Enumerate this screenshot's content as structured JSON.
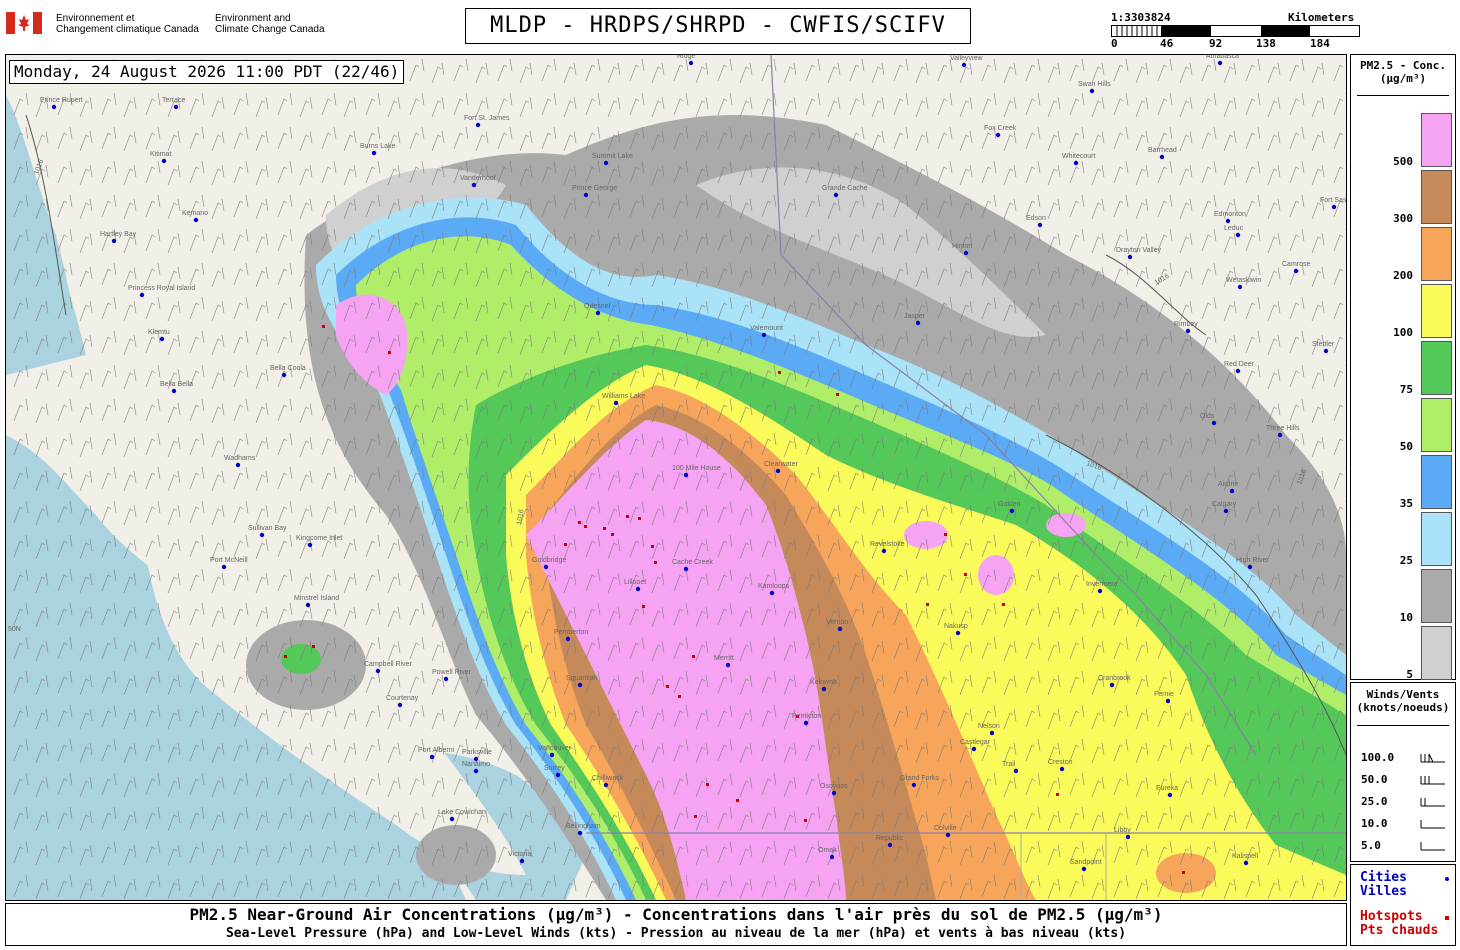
{
  "header": {
    "agency_fr_line1": "Environnement et",
    "agency_fr_line2": "Changement climatique Canada",
    "agency_en_line1": "Environment and",
    "agency_en_line2": "Climate Change Canada",
    "title": "MLDP - HRDPS/SHRPD - CWFIS/SCIFV"
  },
  "scale": {
    "ratio": "1:3303824",
    "unit": "Kilometers",
    "ticks": [
      "0",
      "46",
      "92",
      "138",
      "184"
    ]
  },
  "timestamp": "Monday, 24 August 2026 11:00 PDT (22/46)",
  "legend": {
    "title_line1": "PM2.5 - Conc.",
    "title_line2": "(µg/m³)",
    "classes": [
      {
        "value": "500",
        "color": "#f5a3f2"
      },
      {
        "value": "300",
        "color": "#c68a5a"
      },
      {
        "value": "200",
        "color": "#f7a55a"
      },
      {
        "value": "100",
        "color": "#fafa5a"
      },
      {
        "value": "75",
        "color": "#55c85a"
      },
      {
        "value": "50",
        "color": "#b0ee6a"
      },
      {
        "value": "35",
        "color": "#5aaaf5"
      },
      {
        "value": "25",
        "color": "#aae3f7"
      },
      {
        "value": "10",
        "color": "#aaaaaa"
      },
      {
        "value": "5",
        "color": "#d0d0d0"
      }
    ]
  },
  "winds": {
    "title_line1": "Winds/Vents",
    "title_line2": "(knots/noeuds)",
    "rows": [
      "100.0",
      "50.0",
      "25.0",
      "10.0",
      "5.0"
    ]
  },
  "markers": {
    "cities_en": "Cities",
    "cities_fr": "Villes",
    "cities_color": "#0000cc",
    "hotspots_en": "Hotspots",
    "hotspots_fr": "Pts chauds",
    "hotspots_color": "#cc0000"
  },
  "footer": {
    "line1": "PM2.5 Near-Ground Air Concentrations (µg/m³) - Concentrations dans l'air près du sol de PM2.5 (µg/m³)",
    "line2": "Sea-Level Pressure (hPa) and Low-Level Winds (kts) - Pression au niveau de la mer (hPa) et vents à bas niveau (kts)"
  },
  "map": {
    "isobar_labels": [
      "1016",
      "1016",
      "1016",
      "1016",
      "1016"
    ],
    "latitude_label": "50N",
    "cities": [
      "Prince Rupert",
      "Terrace",
      "Kitimat",
      "Kemano",
      "Hartley Bay",
      "Fort St. James",
      "Burns Lake",
      "Vanderhoof",
      "Prince George",
      "Summit Lake",
      "Ridge",
      "Valleyview",
      "Swan Hills",
      "Athabasca",
      "Fox Creek",
      "Whitecourt",
      "Barrhead",
      "Fort Saskatchewan",
      "Edmonton",
      "Edson",
      "Leduc",
      "Drayton Valley",
      "Camrose",
      "Wetaskiwin",
      "Rimbey",
      "Stettler",
      "Red Deer",
      "Olds",
      "Three Hills",
      "Airdrie",
      "Calgary",
      "High River",
      "Hinton",
      "Grande Cache",
      "Valemount",
      "Jasper",
      "Quesnel",
      "Williams Lake",
      "100 Mile House",
      "Clearwater",
      "Bella Coola",
      "Bella Bella",
      "Klemtu",
      "Princess Royal Island",
      "Wadhams",
      "Sullivan Bay",
      "Kingcome Inlet",
      "Port McNeill",
      "Minstrel Island",
      "Campbell River",
      "Powell River",
      "Courtenay",
      "Port Alberni",
      "Parksville",
      "Nanaimo",
      "Vancouver",
      "Surrey",
      "Lake Cowichan",
      "Victoria",
      "Bellingham",
      "Chilliwack",
      "Squamish",
      "Pemberton",
      "Lillooet",
      "Cache Creek",
      "Kamloops",
      "Merritt",
      "Kelowna",
      "Penticton",
      "Osoyoos",
      "Vernon",
      "Revelstoke",
      "Golden",
      "Invermere",
      "Nakusp",
      "Nelson",
      "Castlegar",
      "Trail",
      "Grand Forks",
      "Republic",
      "Omak",
      "Colville",
      "Cranbrook",
      "Fernie",
      "Creston",
      "Libby",
      "Eureka",
      "Sandpoint",
      "Kalispell",
      "Goldbridge"
    ]
  }
}
